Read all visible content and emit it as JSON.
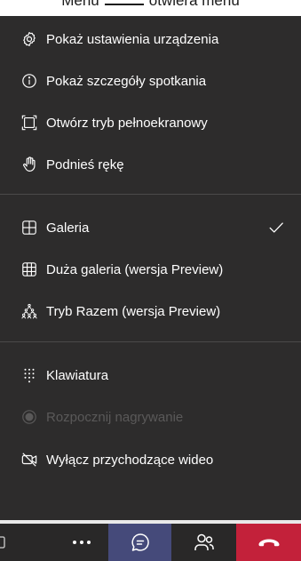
{
  "caption": {
    "left": "Menu",
    "right": "otwiera menu"
  },
  "menu": {
    "group1": [
      {
        "label": "Pokaż ustawienia urządzenia",
        "icon": "settings-gear-icon"
      },
      {
        "label": "Pokaż szczegóły spotkania",
        "icon": "info-icon"
      },
      {
        "label": "Otwórz tryb pełnoekranowy",
        "icon": "fullscreen-icon"
      },
      {
        "label": "Podnieś rękę",
        "icon": "raise-hand-icon"
      }
    ],
    "group2": [
      {
        "label": "Galeria",
        "icon": "gallery-grid-icon",
        "checked": true
      },
      {
        "label": "Duża galeria (wersja Preview)",
        "icon": "large-gallery-icon"
      },
      {
        "label": "Tryb Razem (wersja Preview)",
        "icon": "together-mode-icon"
      }
    ],
    "group3": [
      {
        "label": "Klawiatura",
        "icon": "keypad-icon"
      },
      {
        "label": "Rozpocznij nagrywanie",
        "icon": "record-icon",
        "disabled": true
      },
      {
        "label": "Wyłącz przychodzące wideo",
        "icon": "video-off-icon"
      }
    ]
  },
  "toolbar": {
    "items": [
      "more-options-button",
      "chat-button",
      "participants-button",
      "hang-up-button"
    ]
  },
  "colors": {
    "menu_bg": "#2d2c2c",
    "text": "#ffffff",
    "disabled_text": "#5a5959",
    "chat_active": "#454a7a",
    "hangup": "#c3213a"
  }
}
